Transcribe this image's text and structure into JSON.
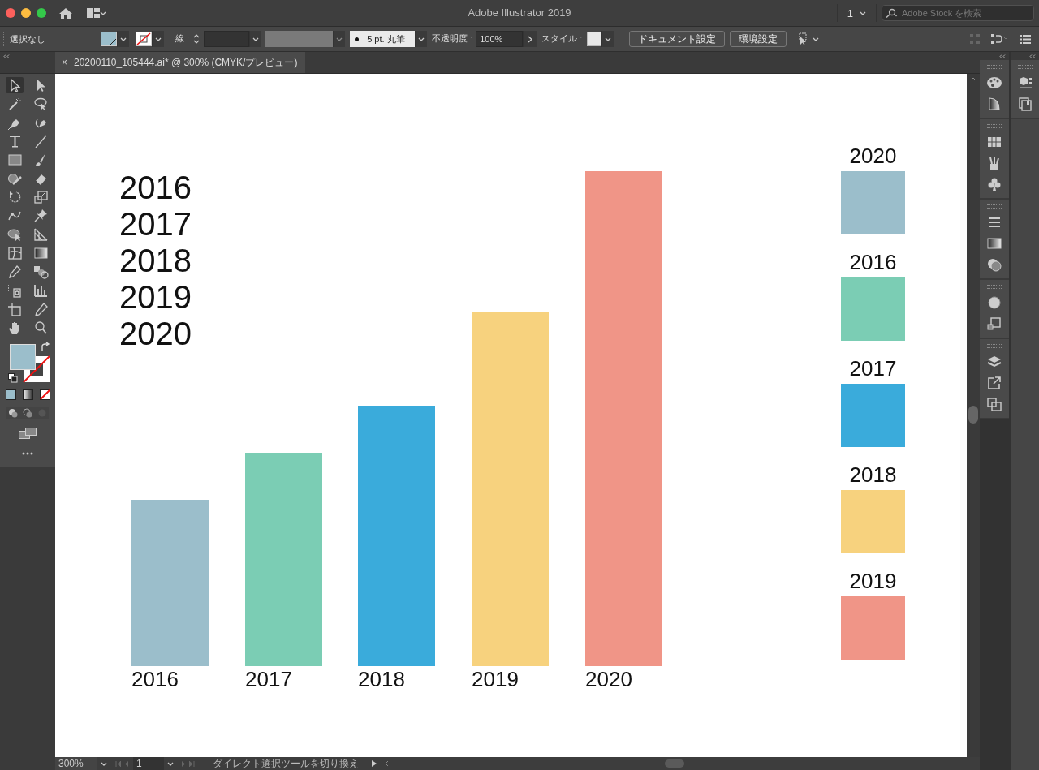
{
  "window": {
    "title": "Adobe Illustrator 2019"
  },
  "title_bar": {
    "arrange_value": "1",
    "search": {
      "placeholder": "Adobe Stock を検索"
    }
  },
  "control_bar": {
    "selection": "選択なし",
    "stroke_label": "線 :",
    "brush": "5 pt. 丸筆",
    "opacity_label": "不透明度 :",
    "opacity": "100%",
    "style_label": "スタイル :",
    "buttons": [
      "ドキュメント設定",
      "環境設定"
    ]
  },
  "document_tab": {
    "close": "×",
    "title": "20200110_105444.ai* @ 300% (CMYK/プレビュー)"
  },
  "artboard": {
    "year_list": [
      "2016",
      "2017",
      "2018",
      "2019",
      "2020"
    ],
    "bars": [
      {
        "label": "2016",
        "color": "#9bbecb"
      },
      {
        "label": "2017",
        "color": "#7bcdb4"
      },
      {
        "label": "2018",
        "color": "#3aabdb"
      },
      {
        "label": "2019",
        "color": "#f7d27e"
      },
      {
        "label": "2020",
        "color": "#f09587"
      }
    ],
    "legend": [
      {
        "label": "2020",
        "color": "#9bbecb"
      },
      {
        "label": "2016",
        "color": "#7bcdb4"
      },
      {
        "label": "2017",
        "color": "#3aabdb"
      },
      {
        "label": "2018",
        "color": "#f7d27e"
      },
      {
        "label": "2019",
        "color": "#f09587"
      }
    ]
  },
  "status_bar": {
    "zoom": "300%",
    "artboard": "1",
    "tool": "ダイレクト選択ツールを切り換え"
  }
}
